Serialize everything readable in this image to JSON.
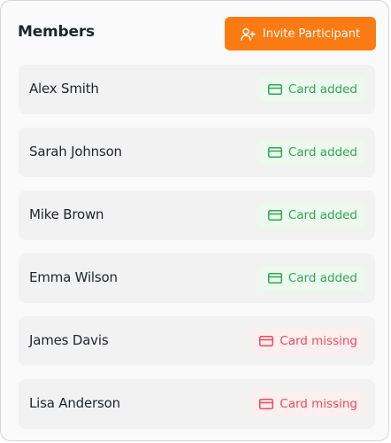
{
  "header": {
    "title": "Members",
    "invite_label": "Invite Participant",
    "invite_icon": "user-plus-icon"
  },
  "colors": {
    "accent": "#fb7b13",
    "ok": "#2fa84f",
    "missing": "#ec4b5a"
  },
  "members": [
    {
      "name": "Alex Smith",
      "status": "Card added",
      "state": "ok"
    },
    {
      "name": "Sarah Johnson",
      "status": "Card added",
      "state": "ok"
    },
    {
      "name": "Mike Brown",
      "status": "Card added",
      "state": "ok"
    },
    {
      "name": "Emma Wilson",
      "status": "Card added",
      "state": "ok"
    },
    {
      "name": "James Davis",
      "status": "Card missing",
      "state": "missing"
    },
    {
      "name": "Lisa Anderson",
      "status": "Card missing",
      "state": "missing"
    }
  ]
}
